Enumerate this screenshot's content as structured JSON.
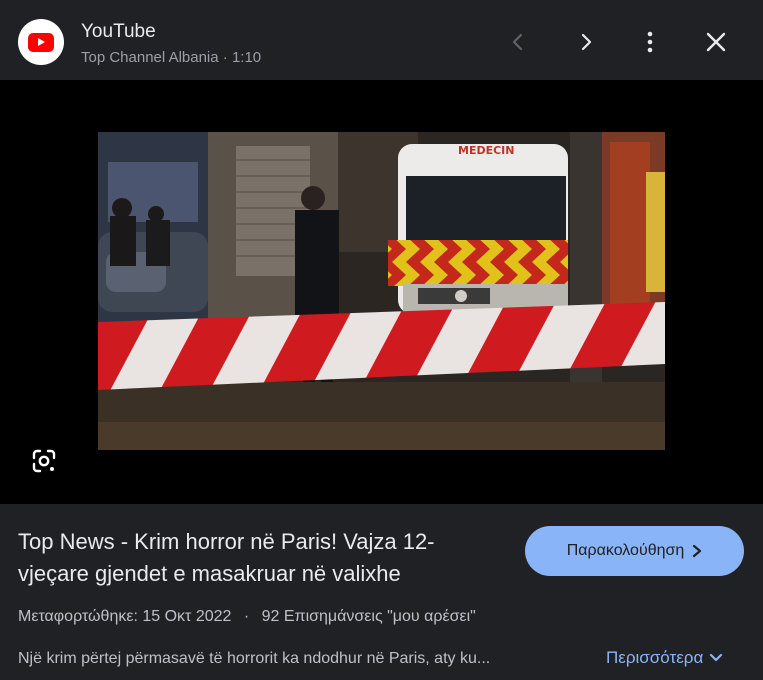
{
  "header": {
    "source_name": "YouTube",
    "channel": "Top Channel Albania",
    "separator": "·",
    "duration": "1:10",
    "icons": {
      "logo": "youtube-logo-icon",
      "prev": "chevron-left-icon",
      "next": "chevron-right-icon",
      "menu": "more-vert-icon",
      "close": "close-icon"
    }
  },
  "media": {
    "ambulance_text": "MEDECIN",
    "lens_icon": "google-lens-icon"
  },
  "info": {
    "title": "Top News - Krim horror në Paris! Vajza 12-vjeçare gjendet e masakruar në valixhe",
    "watch_label": "Παρακολούθηση",
    "watch_icon": "chevron-right-icon",
    "uploaded": "Μεταφορτώθηκε: 15 Οκτ 2022",
    "dot": "·",
    "likes": "92 Επισημάνσεις \"μου αρέσει\"",
    "description": "Një krim përtej përmasavë të horrorit ka ndodhur në Paris, aty ku...",
    "more_label": "Περισσότερα",
    "more_icon": "chevron-down-icon"
  },
  "colors": {
    "background": "#202124",
    "accent": "#8ab4f8",
    "brand_red": "#ff0000",
    "text_primary": "#e8eaed",
    "text_secondary": "#bdc1c6"
  }
}
